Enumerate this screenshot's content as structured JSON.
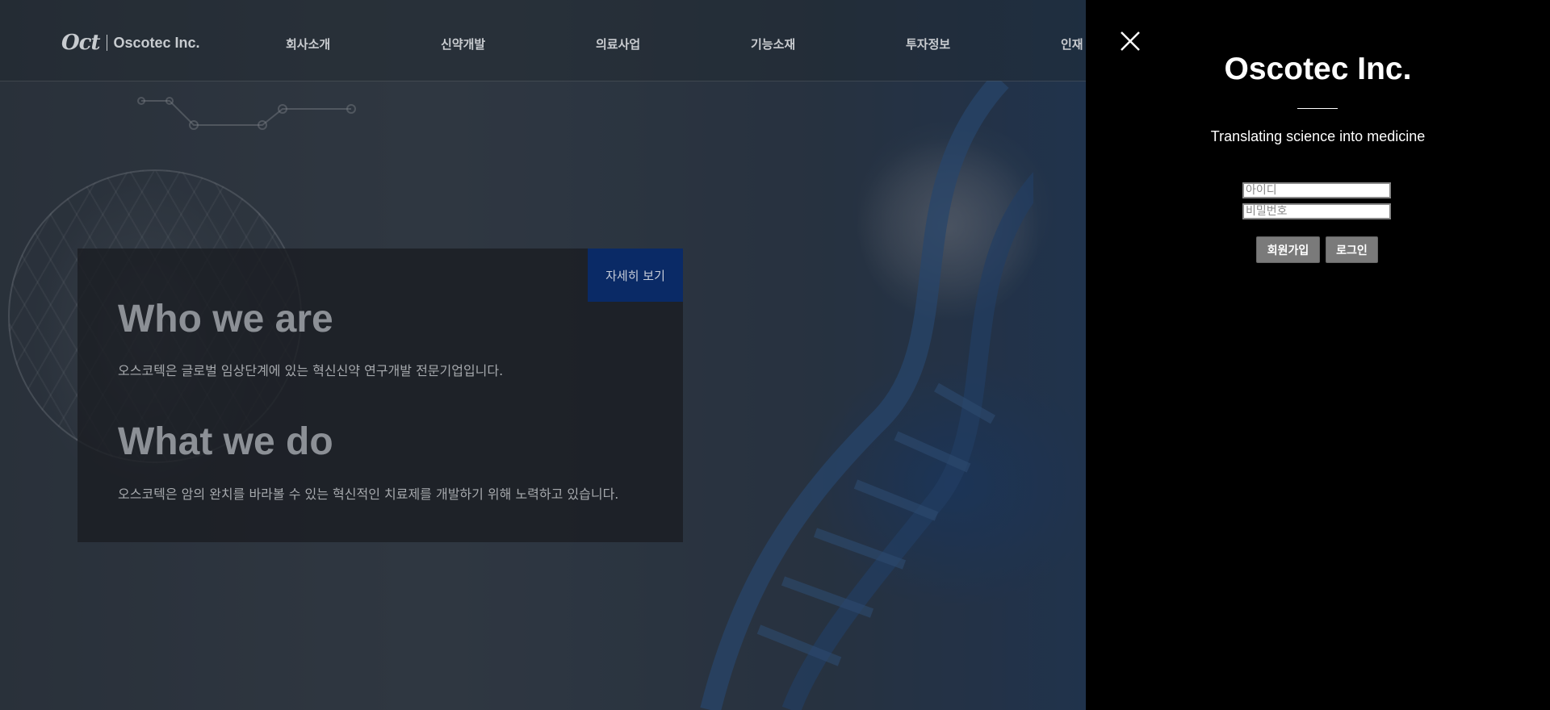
{
  "header": {
    "logo_mark": "Oct",
    "logo_text": "Oscotec Inc.",
    "nav": [
      {
        "label": "회사소개"
      },
      {
        "label": "신약개발"
      },
      {
        "label": "의료사업"
      },
      {
        "label": "기능소재"
      },
      {
        "label": "투자정보"
      },
      {
        "label": "인재"
      }
    ]
  },
  "hero": {
    "more_button": "자세히 보기",
    "who_heading": "Who we are",
    "who_text": "오스코텍은 글로벌 임상단계에 있는 혁신신약 연구개발 전문기업입니다.",
    "what_heading": "What we do",
    "what_text": "오스코텍은 암의 완치를 바라볼 수 있는 혁신적인 치료제를 개발하기 위해 노력하고 있습니다."
  },
  "panel": {
    "close_icon": "close-icon",
    "title": "Oscotec Inc.",
    "tagline": "Translating science into medicine",
    "id_placeholder": "아이디",
    "password_placeholder": "비밀번호",
    "signup_label": "회원가입",
    "login_label": "로그인"
  },
  "colors": {
    "panel_bg": "#000000",
    "accent_button": "#0a2a66",
    "panel_button": "#7a7a7a"
  }
}
